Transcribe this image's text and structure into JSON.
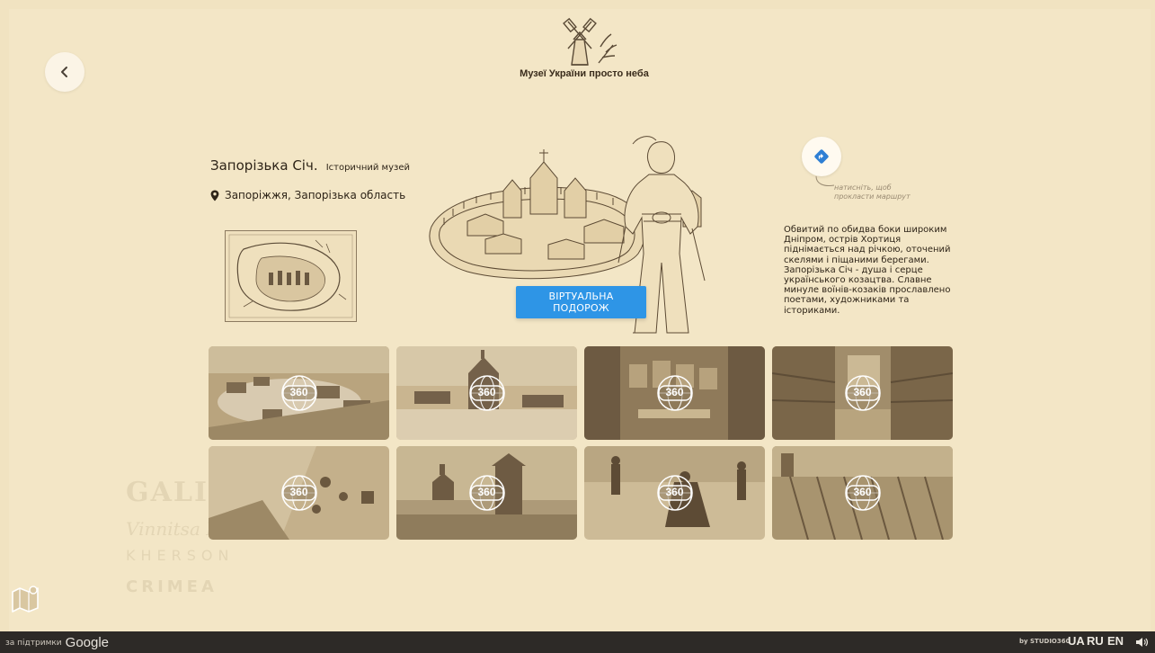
{
  "header": {
    "logo_text": "Музеї України просто неба"
  },
  "place": {
    "name": "Запорізька Січ.",
    "type": "Історичний музей",
    "location": "Запоріжжя, Запорізька область",
    "description": "Обвитий по обидва боки широким Дніпром, острів Хортиця піднімається над річкою, оточений скелями і піщаними берегами. Запорізька Січ - душа і серце українського козацтва. Славне минуле воїнів-козаків прославлено поетами, художниками та істориками."
  },
  "route": {
    "hint": "натисніть, щоб прокласти маршрут"
  },
  "virtual_tour": {
    "label": "ВІРТУАЛЬНА ПОДОРОЖ"
  },
  "gallery": {
    "badge_label": "360",
    "count": 8
  },
  "footer": {
    "support_label": "за підтримки",
    "google_label": "Google",
    "by_studio": "by STUDIO360",
    "languages": [
      "UA",
      "RU",
      "EN"
    ]
  },
  "background_text": {
    "line1": "GALICIA",
    "line2": "Vinnitsa M",
    "line3": "KHERSON",
    "line4": "CRIMEA"
  },
  "colors": {
    "accent": "#2e95e6",
    "background": "#f3e6c6",
    "footer": "#2d2a27"
  },
  "icons": {
    "back": "chevron-left-icon",
    "route": "directions-icon",
    "location": "map-pin-icon",
    "map": "folded-map-icon",
    "sound": "speaker-icon"
  }
}
